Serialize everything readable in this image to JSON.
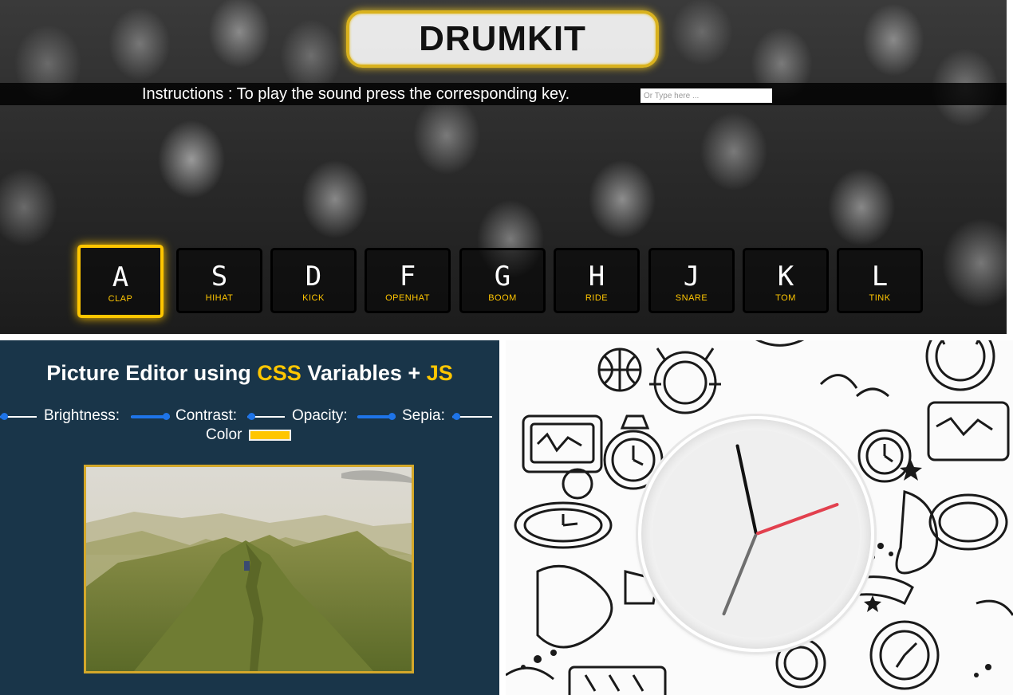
{
  "drumkit": {
    "title": "DRUMKIT",
    "instructions": "Instructions : To play the sound press the corresponding key.",
    "input_placeholder": "Or Type here ...",
    "keys": [
      {
        "letter": "A",
        "sound": "CLAP",
        "active": true
      },
      {
        "letter": "S",
        "sound": "HIHAT",
        "active": false
      },
      {
        "letter": "D",
        "sound": "KICK",
        "active": false
      },
      {
        "letter": "F",
        "sound": "OPENHAT",
        "active": false
      },
      {
        "letter": "G",
        "sound": "BOOM",
        "active": false
      },
      {
        "letter": "H",
        "sound": "RIDE",
        "active": false
      },
      {
        "letter": "J",
        "sound": "SNARE",
        "active": false
      },
      {
        "letter": "K",
        "sound": "TOM",
        "active": false
      },
      {
        "letter": "L",
        "sound": "TINK",
        "active": false
      }
    ],
    "accent_color": "#ffc600"
  },
  "editor": {
    "title_pre": "Picture Editor using ",
    "title_css": "CSS",
    "title_mid": " Variables + ",
    "title_js": "JS",
    "controls": {
      "brightness_label": "Brightness:",
      "contrast_label": "Contrast:",
      "opacity_label": "Opacity:",
      "sepia_label": "Sepia:",
      "color_label": "Color"
    },
    "slider_levels": {
      "first": 0.1,
      "brightness": 1.0,
      "contrast": 0.1,
      "opacity": 1.0,
      "sepia": 0.1
    },
    "selected_color": "#ffc600",
    "background_color": "#193549"
  },
  "clock": {
    "hand_angles_deg": {
      "hour": -102,
      "minute": -20,
      "second": 112
    },
    "second_hand_color": "#e2404e"
  }
}
